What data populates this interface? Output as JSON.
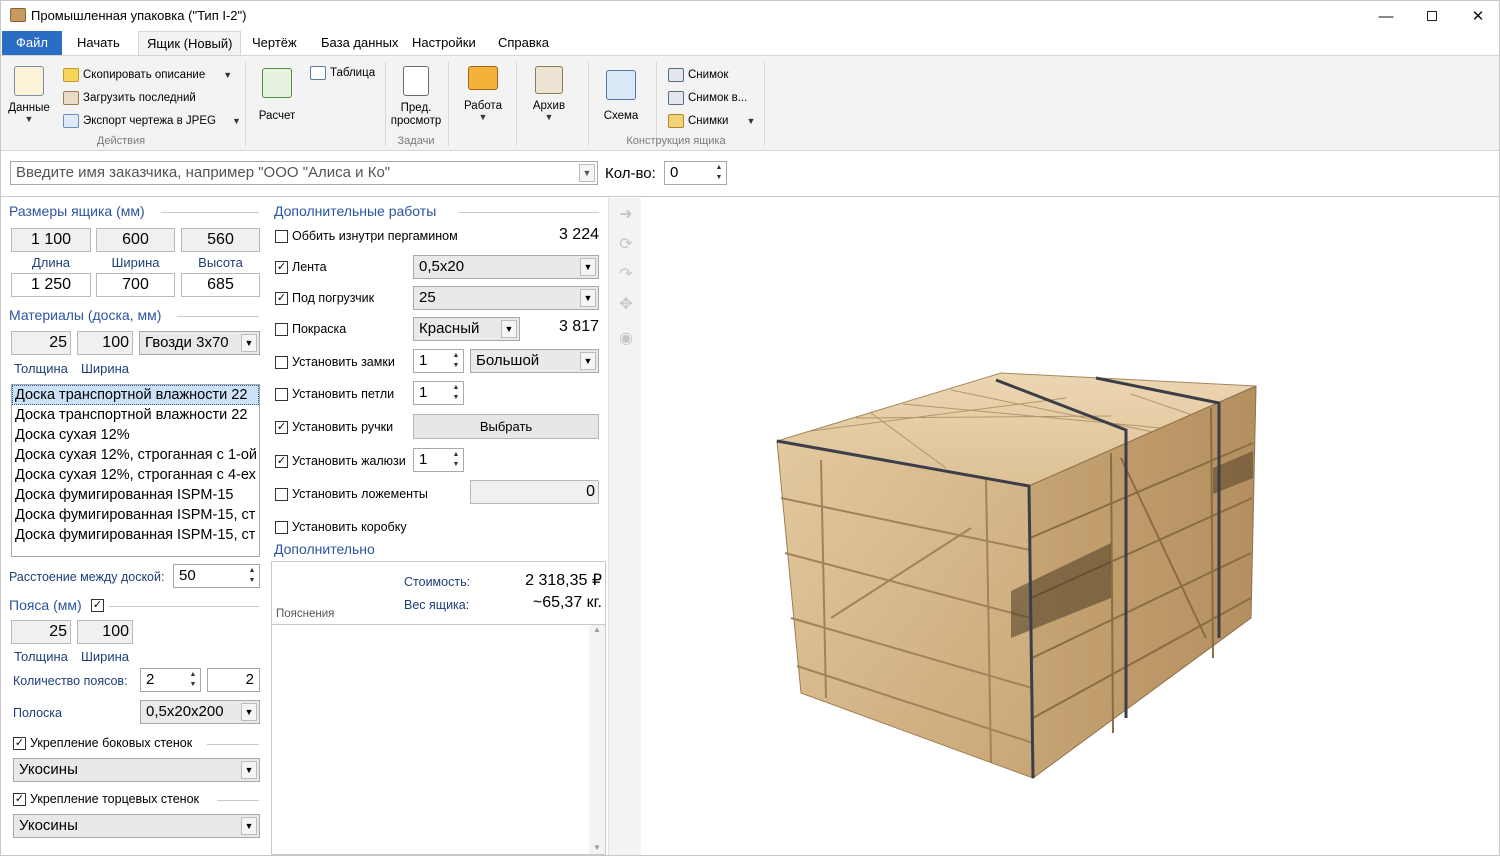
{
  "window": {
    "title": "Промышленная упаковка (\"Тип I-2\")"
  },
  "menu": {
    "file": "Файл",
    "tabs": [
      "Начать",
      "Ящик (Новый)",
      "Чертёж",
      "База данных",
      "Настройки",
      "Справка"
    ]
  },
  "ribbon": {
    "data_label": "Данные",
    "copy_description": "Скопировать описание",
    "load_last": "Загрузить последний",
    "export_jpeg": "Экспорт чертежа в JPEG",
    "actions_group": "Действия",
    "calc_label": "Расчет",
    "table_label": "Таблица",
    "preview_label": "Пред. просмотр",
    "work_label": "Работа",
    "archive_label": "Архив",
    "tasks_group": "Задачи",
    "scheme_label": "Схема",
    "snapshot": "Снимок",
    "snapshot_in": "Снимок в...",
    "snapshots": "Снимки",
    "construction_group": "Конструкция ящика"
  },
  "customer": {
    "placeholder": "Введите имя заказчика, например \"ООО \"Алиса и Ко\"",
    "qty_label": "Кол-во:",
    "qty_value": "0"
  },
  "box": {
    "title": "Размеры ящика (мм)",
    "inner": [
      "1 100",
      "600",
      "560"
    ],
    "dim_labels": [
      "Длина",
      "Ширина",
      "Высота"
    ],
    "outer": [
      "1 250",
      "700",
      "685"
    ]
  },
  "materials": {
    "title": "Материалы (доска, мм)",
    "thickness": "25",
    "width": "100",
    "nails": "Гвозди 3х70",
    "thickness_label": "Толщина",
    "width_label": "Ширина",
    "boards": [
      "Доска транспортной влажности 22",
      "Доска транспортной влажности 22",
      "Доска сухая 12%",
      "Доска сухая 12%, строганная с 1-ой",
      "Доска сухая 12%, строганная с 4-ех",
      "Доска фумигированная ISPM-15",
      "Доска фумигированная ISPM-15, ст",
      "Доска фумигированная ISPM-15, ст"
    ],
    "distance_label": "Расстоение между доской:",
    "distance": "50"
  },
  "belts": {
    "title": "Пояса (мм)",
    "thickness": "25",
    "width": "100",
    "thickness_label": "Толщина",
    "width_label": "Ширина",
    "count_label": "Количество поясов:",
    "count": "2",
    "count2": "2",
    "strip_label": "Полоска",
    "strip": "0,5х20х200",
    "side_label": "Укрепление боковых стенок",
    "side_value": "Укосины",
    "end_label": "Укрепление торцевых стенок",
    "end_value": "Укосины"
  },
  "extra": {
    "title": "Дополнительные работы",
    "parchment": "Оббить изнутри пергамином",
    "parchment_price": "3 224",
    "tape": "Лента",
    "tape_value": "0,5х20",
    "forklift": "Под погрузчик",
    "forklift_value": "25",
    "paint": "Покраска",
    "paint_value": "Красный",
    "paint_price": "3 817",
    "locks": "Установить замки",
    "locks_count": "1",
    "locks_size": "Большой",
    "loops": "Установить петли",
    "loops_count": "1",
    "handles": "Установить ручки",
    "choose": "Выбрать",
    "blinds": "Установить жалюзи",
    "blinds_count": "1",
    "lodgements": "Установить ложементы",
    "lodgements_value": "0",
    "carton": "Установить коробку"
  },
  "additional": {
    "title": "Дополнительно",
    "cost_label": "Стоимость:",
    "cost": "2 318,35 ₽",
    "weight_label": "Вес ящика:",
    "weight": "~65,37 кг.",
    "notes_label": "Пояснения"
  },
  "colors": {
    "accent": "#2b6cc4",
    "wood": "#d8bb8e",
    "strap": "#3b3e48"
  }
}
